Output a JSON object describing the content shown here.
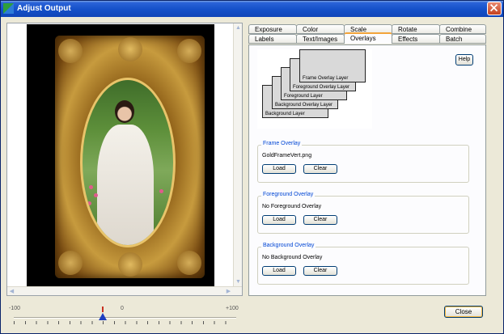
{
  "window": {
    "title": "Adjust Output",
    "close_icon": "close-icon"
  },
  "tabs_row1": [
    {
      "label": "Exposure"
    },
    {
      "label": "Color"
    },
    {
      "label": "Scale"
    },
    {
      "label": "Rotate"
    },
    {
      "label": "Combine"
    }
  ],
  "tabs_row2": [
    {
      "label": "Labels"
    },
    {
      "label": "Text/Images"
    },
    {
      "label": "Overlays"
    },
    {
      "label": "Effects"
    },
    {
      "label": "Batch"
    }
  ],
  "active_tab": "Overlays",
  "help_label": "Help",
  "layers": [
    "Frame Overlay Layer",
    "Foreground Overlay Layer",
    "Foreground Layer",
    "Background Overlay Layer",
    "Background Layer"
  ],
  "frame_overlay": {
    "label": "Frame Overlay",
    "value": "GoldFrameVert.png",
    "load": "Load",
    "clear": "Clear"
  },
  "foreground_overlay": {
    "label": "Foreground Overlay",
    "value": "No Foreground Overlay",
    "load": "Load",
    "clear": "Clear"
  },
  "background_overlay": {
    "label": "Background Overlay",
    "value": "No Background Overlay",
    "load": "Load",
    "clear": "Clear"
  },
  "slider": {
    "min_label": "-100",
    "mid_label": "0",
    "max_label": "+100",
    "value": -20
  },
  "close_label": "Close",
  "colors": {
    "title_bar": "#1450c8",
    "group_label": "#0046d5",
    "active_tab_accent": "#f2a43a"
  }
}
